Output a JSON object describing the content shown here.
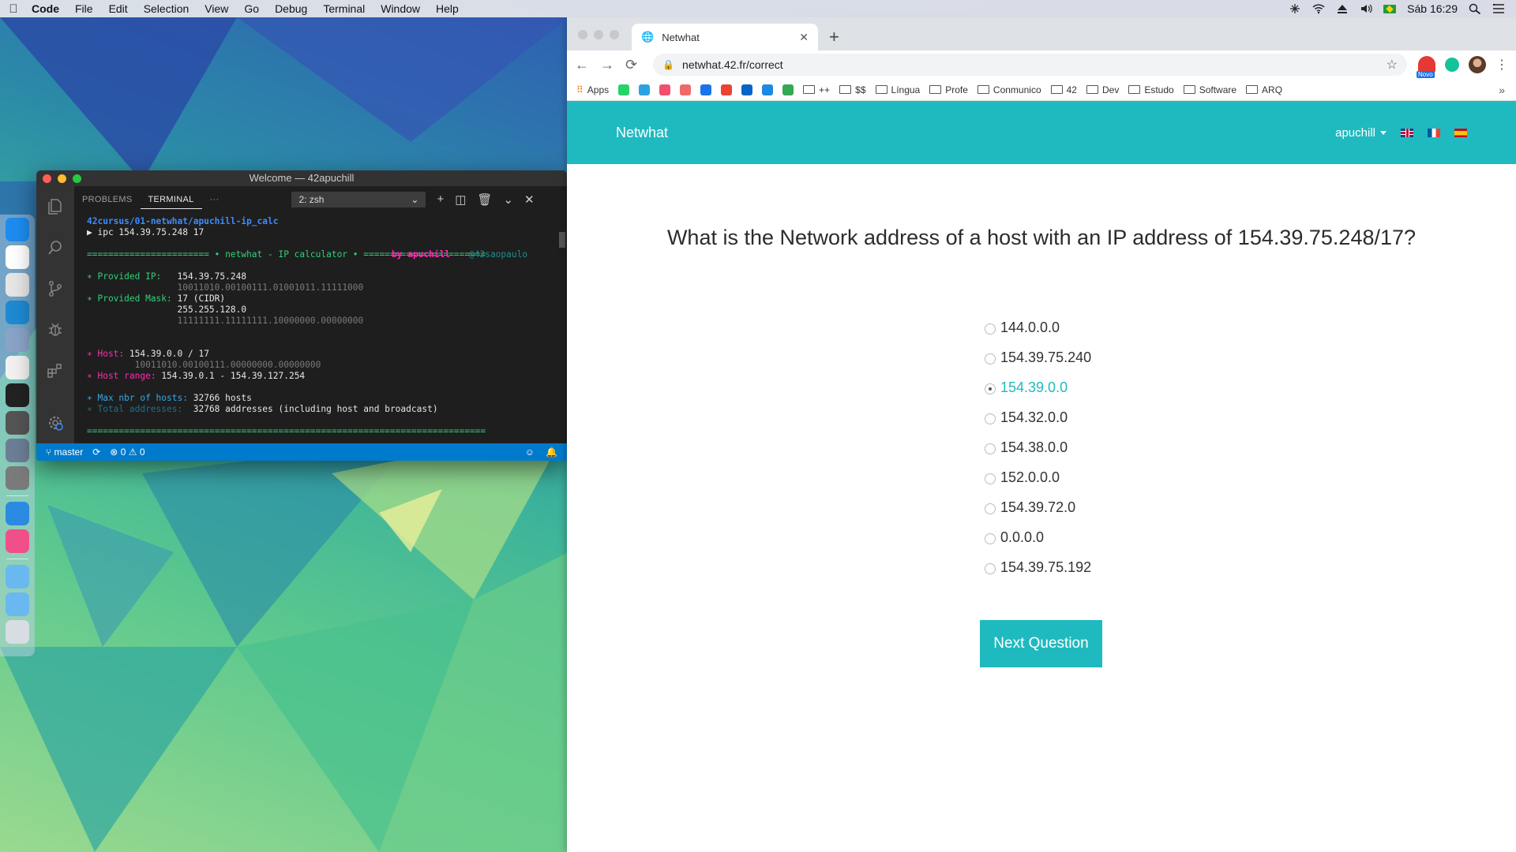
{
  "menubar": {
    "app_name": "Code",
    "items": [
      "File",
      "Edit",
      "Selection",
      "View",
      "Go",
      "Debug",
      "Terminal",
      "Window",
      "Help"
    ],
    "clock": "Sáb 16:29"
  },
  "dock": {
    "apps": [
      {
        "icon": "finder-icon",
        "color": "#1d8cf0"
      },
      {
        "icon": "slack-icon",
        "color": "#ffffff"
      },
      {
        "icon": "chrome-icon",
        "color": "#e6e6e6"
      },
      {
        "icon": "vscode-icon",
        "color": "#1f8ad2"
      },
      {
        "icon": "preview-icon",
        "color": "#8aa4c8"
      },
      {
        "icon": "textedit-icon",
        "color": "#f2f2f2"
      },
      {
        "icon": "terminal-icon",
        "color": "#222222"
      },
      {
        "icon": "disk-utility-icon",
        "color": "#555555"
      },
      {
        "icon": "launchpad-icon",
        "color": "#6d7f96"
      },
      {
        "icon": "system-preferences-icon",
        "color": "#7b7b7b"
      },
      {
        "icon": "safari-icon",
        "color": "#2b8be0"
      },
      {
        "icon": "itunes-icon",
        "color": "#f04f8a"
      },
      {
        "icon": "folder-icon",
        "color": "#6ab8f0"
      },
      {
        "icon": "folder-icon",
        "color": "#6ab8f0"
      },
      {
        "icon": "trash-icon",
        "color": "#d8dde3"
      }
    ]
  },
  "vscode": {
    "title": "Welcome — 42apuchill",
    "tabs": {
      "problems": "PROBLEMS",
      "terminal": "TERMINAL",
      "more": "···"
    },
    "terminal_select": "2: zsh",
    "status": {
      "branch": "master",
      "errors": "0",
      "warnings": "0"
    },
    "terminal": {
      "path": "42cursus/01-netwhat/apuchill-ip_calc",
      "command": "▶ ipc 154.39.75.248 17",
      "banner": "======================= • netwhat - IP calculator • =======================",
      "by": "by apuchill",
      "handle": "@42saopaulo",
      "ip_label": "∗ Provided IP:",
      "ip_value": "154.39.75.248",
      "ip_binary": "10011010.00100111.01001011.11111000",
      "mask_label": "∗ Provided Mask:",
      "mask_cidr": "17 (CIDR)",
      "mask_value": "255.255.128.0",
      "mask_binary": "11111111.11111111.10000000.00000000",
      "host_label": "∗ Host:",
      "host_value": "154.39.0.0 / 17",
      "host_binary": "10011010.00100111.00000000.00000000",
      "range_label": "∗ Host range:",
      "range_value": "154.39.0.1 - 154.39.127.254",
      "max_label": "∗ Max nbr of hosts:",
      "max_value": "32766 hosts",
      "total_label": "∗ Total addresses:",
      "total_value": "32768 addresses (including host and broadcast)",
      "footer": "==========================================================================="
    }
  },
  "browser": {
    "tab_title": "Netwhat",
    "url": "netwhat.42.fr/correct",
    "extension_badge": "Novo",
    "bookmarks": [
      {
        "label": "Apps",
        "type": "apps"
      },
      {
        "label": "",
        "type": "ico",
        "color": "#25d366"
      },
      {
        "label": "",
        "type": "ico",
        "color": "#2aa3e0"
      },
      {
        "label": "",
        "type": "ico",
        "color": "#f0506e"
      },
      {
        "label": "",
        "type": "ico",
        "color": "#f06a6a"
      },
      {
        "label": "",
        "type": "ico",
        "color": "#1a73e8"
      },
      {
        "label": "",
        "type": "ico",
        "color": "#ea4335"
      },
      {
        "label": "",
        "type": "ico",
        "color": "#0a64c8"
      },
      {
        "label": "",
        "type": "ico",
        "color": "#1e88e5"
      },
      {
        "label": "",
        "type": "ico",
        "color": "#34a853"
      },
      {
        "label": "++",
        "type": "folder"
      },
      {
        "label": "$$",
        "type": "folder"
      },
      {
        "label": "Língua",
        "type": "folder"
      },
      {
        "label": "Profe",
        "type": "folder"
      },
      {
        "label": "Conmunico",
        "type": "folder"
      },
      {
        "label": "42",
        "type": "folder"
      },
      {
        "label": "Dev",
        "type": "folder"
      },
      {
        "label": "Estudo",
        "type": "folder"
      },
      {
        "label": "Software",
        "type": "folder"
      },
      {
        "label": "ARQ",
        "type": "folder"
      }
    ],
    "bookmarks_more": "»"
  },
  "page": {
    "brand": "Netwhat",
    "user": "apuchill",
    "accent": "#1fbabf",
    "question": "What is the Network address of a host with an IP address of 154.39.75.248/17?",
    "options": [
      {
        "label": "144.0.0.0",
        "selected": false
      },
      {
        "label": "154.39.75.240",
        "selected": false
      },
      {
        "label": "154.39.0.0",
        "selected": true
      },
      {
        "label": "154.32.0.0",
        "selected": false
      },
      {
        "label": "154.38.0.0",
        "selected": false
      },
      {
        "label": "152.0.0.0",
        "selected": false
      },
      {
        "label": "154.39.72.0",
        "selected": false
      },
      {
        "label": "0.0.0.0",
        "selected": false
      },
      {
        "label": "154.39.75.192",
        "selected": false
      }
    ],
    "next_button": "Next Question"
  }
}
